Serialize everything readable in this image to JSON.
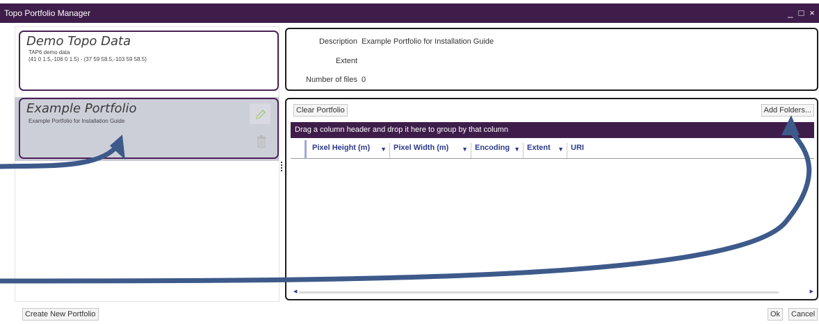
{
  "window": {
    "title": "Topo Portfolio Manager",
    "minimize_glyph": "_",
    "maximize_glyph": "□",
    "close_glyph": "×"
  },
  "portfolios": [
    {
      "name": "Demo Topo Data",
      "description": "TAP6 demo data",
      "extent": "(41 0 1.5,-106 0 1.5) - (37 59 58.5,-103 59 58.5)"
    },
    {
      "name": "Example Portfolio",
      "description": "Example Portfolio for Installation Guide",
      "selected": true
    }
  ],
  "details": {
    "description_label": "Description",
    "description_value": "Example Portfolio for Installation Guide",
    "extent_label": "Extent",
    "extent_value": "",
    "files_label": "Number of files",
    "files_value": "0"
  },
  "grid": {
    "clear_label": "Clear Portfolio",
    "add_folders_label": "Add Folders...",
    "group_hint": "Drag a column header and drop it here to group by that column",
    "columns": [
      "Pixel Height (m)",
      "Pixel Width (m)",
      "Encoding",
      "Extent",
      "URI"
    ]
  },
  "footer": {
    "create_label": "Create New Portfolio",
    "ok_label": "Ok",
    "cancel_label": "Cancel"
  },
  "colors": {
    "titlebar": "#3f1d4a",
    "accent_border": "#4a2157",
    "header_text": "#2b3a8c",
    "arrow": "#3d5a8a"
  },
  "icons": {
    "edit": "pencil-icon",
    "delete": "trash-icon",
    "filter": "funnel-icon"
  }
}
